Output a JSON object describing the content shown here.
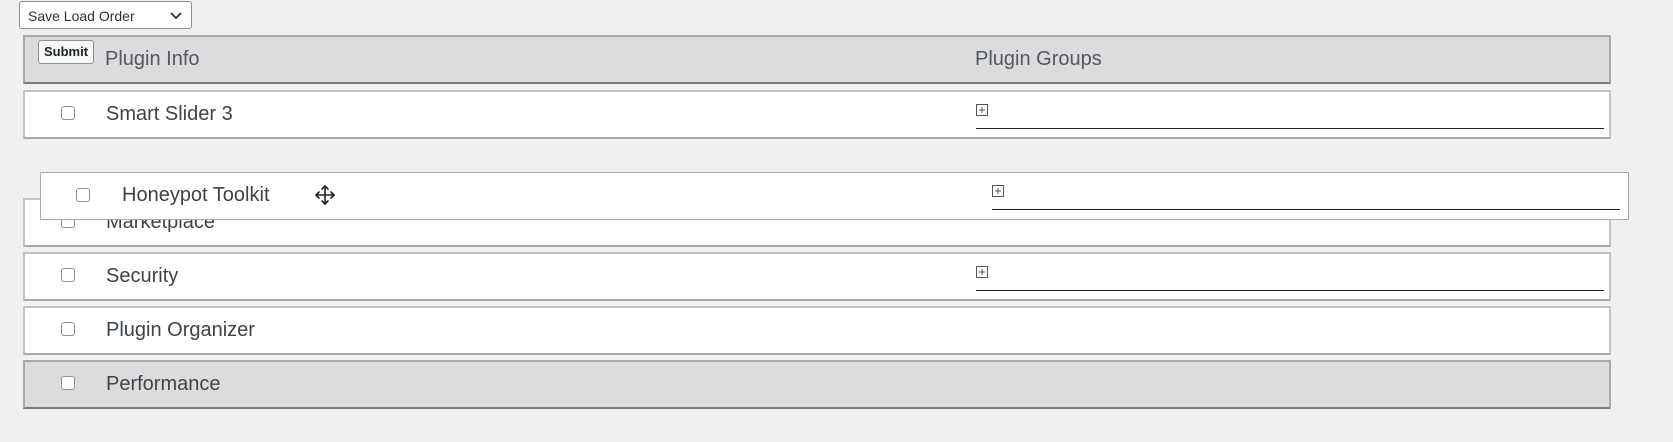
{
  "toolbar": {
    "select_value": "Save Load Order"
  },
  "header": {
    "submit_label": "Submit",
    "col_plugin_info": "Plugin Info",
    "col_plugin_groups": "Plugin Groups"
  },
  "rows": [
    {
      "name": "Smart Slider 3",
      "has_group_field": true
    },
    {
      "name": "Marketplace",
      "has_group_field": false
    },
    {
      "name": "Security",
      "has_group_field": true
    },
    {
      "name": "Plugin Organizer",
      "has_group_field": false
    },
    {
      "name": "Performance",
      "has_group_field": false
    }
  ],
  "dragging": {
    "name": "Honeypot Toolkit",
    "has_group_field": true
  },
  "icons": {
    "dropdown": "chevron-down-icon",
    "add_group": "plus-square-icon",
    "drag": "move-icon"
  }
}
